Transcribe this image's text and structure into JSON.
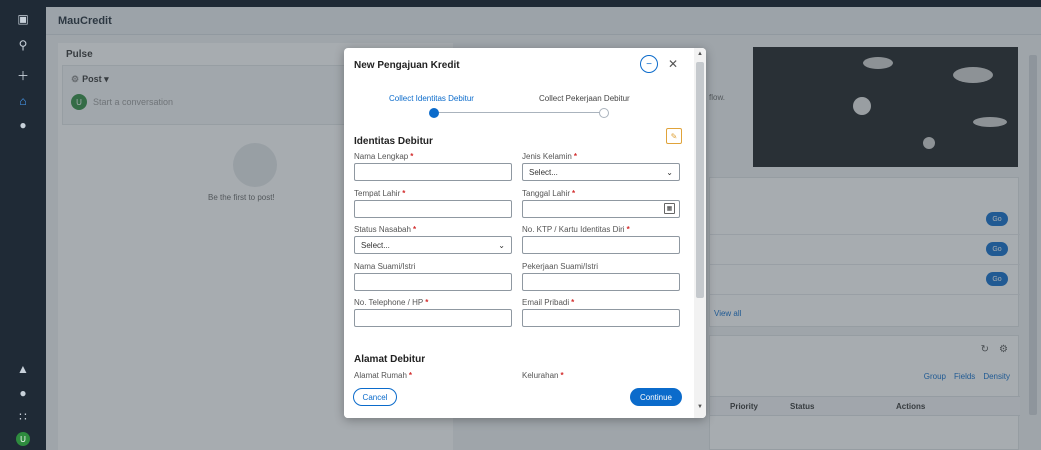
{
  "app": {
    "title": "MauCredit",
    "user_initial": "U"
  },
  "pulse": {
    "title": "Pulse",
    "post_label": "Post",
    "conversation_placeholder": "Start a conversation",
    "empty_text": "Be the first to post!"
  },
  "right": {
    "banner_text": "flow.",
    "go_label": "Go",
    "view_all": "View all",
    "table_tools": {
      "group": "Group",
      "fields": "Fields",
      "density": "Density"
    },
    "table_headers": {
      "priority": "Priority",
      "status": "Status",
      "actions": "Actions"
    }
  },
  "modal": {
    "title": "New Pengajuan Kredit",
    "steps": [
      {
        "label": "Collect Identitas Debitur",
        "active": true
      },
      {
        "label": "Collect Pekerjaan Debitur",
        "active": false
      }
    ],
    "section_identitas": "Identitas Debitur",
    "section_alamat": "Alamat Debitur",
    "fields": {
      "nama_lengkap": {
        "label": "Nama Lengkap",
        "value": ""
      },
      "jenis_kelamin": {
        "label": "Jenis Kelamin",
        "value": "Select..."
      },
      "tempat_lahir": {
        "label": "Tempat Lahir",
        "value": ""
      },
      "tanggal_lahir": {
        "label": "Tanggal Lahir",
        "value": ""
      },
      "status_nasabah": {
        "label": "Status Nasabah",
        "value": "Select..."
      },
      "no_ktp": {
        "label": "No. KTP / Kartu Identitas Diri",
        "value": ""
      },
      "nama_suami": {
        "label": "Nama Suami/Istri",
        "value": ""
      },
      "pekerjaan_suami": {
        "label": "Pekerjaan Suami/Istri",
        "value": ""
      },
      "no_telephone": {
        "label": "No. Telephone / HP",
        "value": ""
      },
      "email_pribadi": {
        "label": "Email Pribadi",
        "value": ""
      },
      "alamat_rumah": {
        "label": "Alamat Rumah"
      },
      "kelurahan": {
        "label": "Kelurahan"
      }
    },
    "cancel_label": "Cancel",
    "continue_label": "Continue"
  },
  "colors": {
    "primary": "#0b6bcb",
    "rail": "#1f2a36",
    "required": "#d32f2f",
    "edit": "#e0a33a"
  }
}
